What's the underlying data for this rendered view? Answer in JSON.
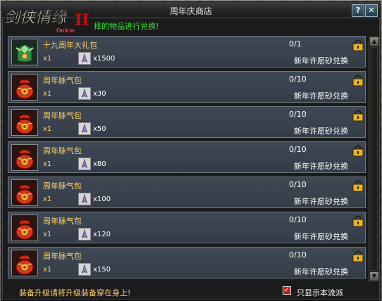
{
  "window": {
    "title": "周年庆商店",
    "help_label": "?",
    "close_label": "✕"
  },
  "logo": {
    "text": "剑侠情缘",
    "subtext": "Online",
    "numeral": "II"
  },
  "hint": "择的物品进行兑换!",
  "items": [
    {
      "name": "十九周年大礼包",
      "qty": "x1",
      "cost": "x1500",
      "limit": "0/1",
      "exchange": "新年许愿砂兑换",
      "icon": "gift-pack-icon"
    },
    {
      "name": "周年脉气包",
      "qty": "x1",
      "cost": "x30",
      "limit": "0/10",
      "exchange": "新年许愿砂兑换",
      "icon": "red-bag-icon"
    },
    {
      "name": "周年脉气包",
      "qty": "x1",
      "cost": "x50",
      "limit": "0/10",
      "exchange": "新年许愿砂兑换",
      "icon": "red-bag-icon"
    },
    {
      "name": "周年脉气包",
      "qty": "x1",
      "cost": "x80",
      "limit": "0/10",
      "exchange": "新年许愿砂兑换",
      "icon": "red-bag-icon"
    },
    {
      "name": "周年脉气包",
      "qty": "x1",
      "cost": "x100",
      "limit": "0/10",
      "exchange": "新年许愿砂兑换",
      "icon": "red-bag-icon"
    },
    {
      "name": "周年脉气包",
      "qty": "x1",
      "cost": "x120",
      "limit": "0/10",
      "exchange": "新年许愿砂兑换",
      "icon": "red-bag-icon"
    },
    {
      "name": "周年脉气包",
      "qty": "x1",
      "cost": "x150",
      "limit": "0/10",
      "exchange": "新年许愿砂兑换",
      "icon": "red-bag-icon"
    }
  ],
  "footer": {
    "note": "装备升级请将升级装备穿在身上!",
    "checkbox_checked": true,
    "checkbox_label": "只显示本流派"
  },
  "colors": {
    "item_text": "#ffd26a",
    "hint_text": "#3ce03c",
    "row_bg": "#3a4350"
  }
}
